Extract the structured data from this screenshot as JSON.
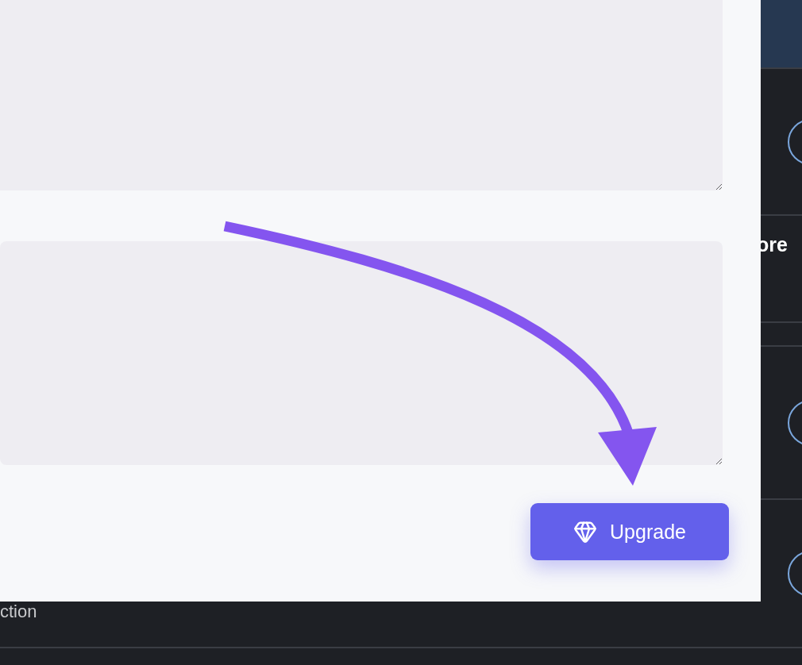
{
  "background": {
    "heading": "ore",
    "caption": "ction"
  },
  "dialog": {
    "upgrade_button": {
      "label": "Upgrade"
    }
  }
}
